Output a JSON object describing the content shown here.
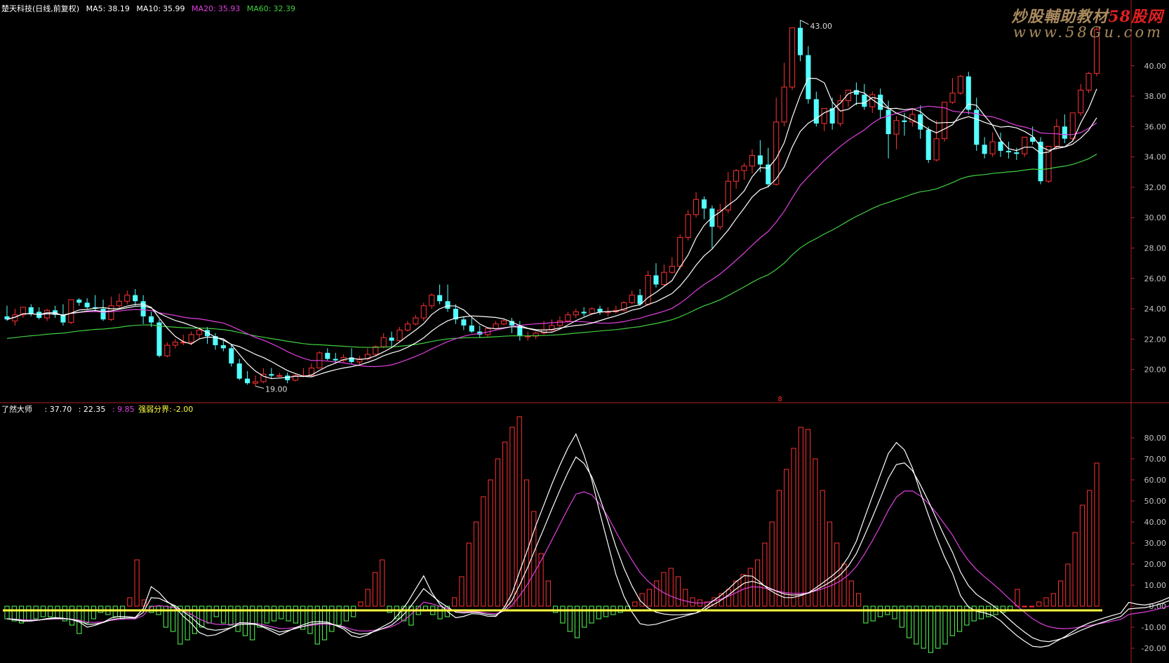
{
  "header": {
    "stock_title": "楚天科技(日线,前复权)",
    "ma5": {
      "label": "MA5:",
      "value": "38.19",
      "color": "#ffffff"
    },
    "ma10": {
      "label": "MA10:",
      "value": "35.99",
      "color": "#ffffff"
    },
    "ma20": {
      "label": "MA20:",
      "value": "35.93",
      "color": "#e040e0"
    },
    "ma60": {
      "label": "MA60:",
      "value": "32.39",
      "color": "#40d040"
    }
  },
  "watermark": {
    "line1_prefix": "炒股輔助教材",
    "line1_brand": "58股网",
    "line2": "www.58Gu.com"
  },
  "price_panel": {
    "y_ticks": [
      "20.00",
      "22.00",
      "24.00",
      "26.00",
      "28.00",
      "30.00",
      "32.00",
      "34.00",
      "36.00",
      "38.00",
      "40.00"
    ],
    "high_annotation": "43.00",
    "low_annotation": "19.00",
    "marker_label": "8"
  },
  "indicator_panel": {
    "title": "了然大师",
    "values": [
      {
        "text": ": 37.70",
        "color": "#ffffff"
      },
      {
        "text": ": 22.35",
        "color": "#ffffff"
      },
      {
        "text": ": 9.85",
        "color": "#e040e0"
      }
    ],
    "boundary": {
      "label": "强弱分界:",
      "value": "-2.00",
      "color": "#ffff40"
    },
    "y_ticks": [
      "-20.00",
      "-10.00",
      "0.00",
      "10.00",
      "20.00",
      "30.00",
      "40.00",
      "50.00",
      "60.00",
      "70.00",
      "80.00"
    ]
  },
  "chart_data": [
    {
      "type": "candlestick",
      "title": "楚天科技(日线,前复权)",
      "ylim": [
        18,
        43.5
      ],
      "up_color": "#ff3232",
      "down_color": "#54ffff",
      "candles": [
        [
          23.5,
          24.2,
          23.3,
          23.2
        ],
        [
          23.2,
          24.0,
          23.6,
          22.9
        ],
        [
          23.6,
          24.1,
          24.1,
          23.4
        ],
        [
          24.1,
          24.3,
          23.7,
          23.5
        ],
        [
          23.8,
          24.1,
          23.4,
          23.3
        ],
        [
          23.4,
          24.0,
          23.9,
          23.2
        ],
        [
          23.9,
          24.2,
          23.6,
          23.4
        ],
        [
          23.6,
          24.3,
          23.1,
          22.9
        ],
        [
          23.1,
          24.6,
          24.6,
          23.0
        ],
        [
          24.6,
          24.7,
          24.4,
          24.2
        ],
        [
          24.4,
          24.7,
          24.1,
          24.0
        ],
        [
          24.1,
          24.9,
          24.0,
          23.8
        ],
        [
          24.0,
          24.6,
          23.3,
          23.2
        ],
        [
          23.3,
          24.8,
          24.2,
          23.2
        ],
        [
          24.2,
          25.0,
          24.5,
          24.0
        ],
        [
          24.5,
          25.2,
          24.9,
          24.3
        ],
        [
          24.9,
          25.3,
          24.5,
          24.2
        ],
        [
          24.5,
          24.9,
          23.5,
          23.0
        ],
        [
          23.5,
          23.8,
          23.1,
          22.8
        ],
        [
          23.1,
          23.3,
          20.9,
          20.8
        ],
        [
          20.9,
          21.8,
          21.6,
          20.8
        ],
        [
          21.6,
          22.0,
          21.8,
          21.4
        ],
        [
          21.8,
          22.3,
          21.8,
          21.6
        ],
        [
          21.8,
          22.5,
          22.3,
          21.6
        ],
        [
          22.3,
          22.7,
          22.6,
          22.0
        ],
        [
          22.6,
          22.8,
          22.2,
          21.7
        ],
        [
          22.2,
          22.4,
          21.6,
          21.3
        ],
        [
          21.6,
          21.9,
          21.4,
          21.2
        ],
        [
          21.4,
          21.7,
          20.4,
          20.2
        ],
        [
          20.4,
          20.7,
          19.4,
          19.3
        ],
        [
          19.4,
          19.9,
          19.1,
          19.0
        ],
        [
          19.1,
          19.6,
          19.2,
          18.9
        ],
        [
          19.2,
          20.1,
          19.7,
          19.1
        ],
        [
          19.7,
          20.1,
          19.6,
          19.4
        ],
        [
          19.6,
          19.8,
          19.6,
          19.5
        ],
        [
          19.6,
          19.8,
          19.3,
          19.1
        ],
        [
          19.3,
          19.7,
          19.6,
          19.2
        ],
        [
          19.6,
          20.1,
          19.6,
          19.5
        ],
        [
          19.6,
          20.4,
          20.1,
          19.5
        ],
        [
          20.1,
          21.2,
          21.1,
          20.1
        ],
        [
          21.1,
          21.4,
          20.7,
          20.6
        ],
        [
          20.7,
          21.1,
          20.6,
          20.4
        ],
        [
          20.6,
          21.0,
          20.8,
          20.5
        ],
        [
          20.8,
          21.4,
          20.5,
          20.4
        ],
        [
          20.5,
          20.9,
          20.7,
          20.3
        ],
        [
          20.7,
          21.4,
          21.0,
          20.6
        ],
        [
          21.0,
          21.6,
          21.5,
          20.9
        ],
        [
          21.5,
          22.4,
          22.1,
          21.4
        ],
        [
          22.1,
          22.5,
          21.9,
          21.5
        ],
        [
          21.9,
          22.8,
          22.6,
          21.8
        ],
        [
          22.6,
          23.2,
          23.0,
          22.5
        ],
        [
          23.0,
          23.6,
          23.4,
          22.9
        ],
        [
          23.4,
          24.4,
          24.2,
          23.2
        ],
        [
          24.2,
          25.0,
          24.9,
          24.0
        ],
        [
          24.9,
          25.6,
          24.5,
          24.3
        ],
        [
          24.5,
          25.6,
          24.0,
          23.8
        ],
        [
          24.0,
          24.3,
          23.3,
          23.0
        ],
        [
          23.3,
          23.5,
          22.9,
          22.6
        ],
        [
          22.9,
          23.4,
          22.5,
          22.4
        ],
        [
          22.5,
          22.9,
          22.3,
          22.1
        ],
        [
          22.3,
          22.8,
          22.7,
          22.1
        ],
        [
          22.7,
          23.2,
          23.0,
          22.6
        ],
        [
          23.0,
          23.3,
          23.2,
          22.9
        ],
        [
          23.2,
          23.4,
          22.9,
          22.4
        ],
        [
          22.9,
          23.2,
          22.2,
          21.9
        ],
        [
          22.2,
          22.5,
          22.2,
          21.9
        ],
        [
          22.2,
          22.5,
          22.4,
          22.0
        ],
        [
          22.4,
          23.2,
          22.6,
          22.3
        ],
        [
          22.6,
          23.3,
          22.9,
          22.5
        ],
        [
          22.9,
          23.5,
          23.2,
          22.8
        ],
        [
          23.2,
          23.8,
          23.6,
          23.1
        ],
        [
          23.6,
          24.0,
          23.8,
          23.4
        ],
        [
          23.8,
          24.1,
          23.7,
          23.5
        ],
        [
          23.7,
          24.1,
          24.0,
          23.6
        ],
        [
          24.0,
          24.2,
          23.8,
          23.6
        ],
        [
          23.8,
          24.1,
          23.8,
          23.5
        ],
        [
          23.8,
          24.2,
          23.9,
          23.7
        ],
        [
          23.9,
          24.5,
          24.4,
          23.8
        ],
        [
          24.4,
          25.2,
          24.9,
          24.3
        ],
        [
          24.9,
          25.3,
          24.3,
          24.2
        ],
        [
          24.3,
          26.5,
          26.2,
          24.2
        ],
        [
          26.2,
          27.0,
          25.6,
          25.4
        ],
        [
          25.6,
          26.9,
          26.4,
          25.5
        ],
        [
          26.4,
          27.4,
          26.8,
          26.3
        ],
        [
          26.8,
          28.9,
          28.7,
          26.6
        ],
        [
          28.7,
          30.5,
          30.2,
          28.5
        ],
        [
          30.2,
          31.7,
          31.2,
          30.0
        ],
        [
          31.2,
          31.4,
          30.6,
          29.9
        ],
        [
          30.6,
          30.8,
          29.4,
          28.0
        ],
        [
          29.4,
          30.9,
          30.5,
          29.2
        ],
        [
          30.5,
          33.0,
          32.4,
          30.3
        ],
        [
          32.4,
          33.2,
          33.1,
          31.9
        ],
        [
          33.1,
          33.6,
          33.4,
          32.5
        ],
        [
          33.4,
          34.5,
          34.1,
          32.9
        ],
        [
          34.1,
          35.1,
          33.5,
          33.0
        ],
        [
          33.5,
          34.6,
          32.2,
          32.0
        ],
        [
          32.2,
          37.9,
          36.3,
          32.1
        ],
        [
          36.3,
          40.2,
          38.6,
          36.0
        ],
        [
          38.6,
          41.6,
          42.5,
          38.4
        ],
        [
          42.5,
          43.0,
          40.7,
          40.3
        ],
        [
          40.7,
          41.3,
          37.8,
          37.5
        ],
        [
          37.8,
          38.3,
          36.2,
          36.0
        ],
        [
          36.2,
          37.2,
          37.2,
          35.7
        ],
        [
          37.2,
          37.9,
          36.2,
          35.8
        ],
        [
          36.2,
          38.1,
          37.7,
          36.0
        ],
        [
          37.7,
          38.4,
          38.4,
          37.3
        ],
        [
          38.4,
          38.9,
          38.1,
          37.4
        ],
        [
          38.1,
          38.8,
          37.3,
          37.1
        ],
        [
          37.3,
          38.3,
          38.1,
          36.9
        ],
        [
          38.1,
          38.5,
          37.1,
          36.5
        ],
        [
          37.1,
          37.7,
          35.5,
          33.9
        ],
        [
          35.5,
          36.7,
          36.4,
          34.5
        ],
        [
          36.4,
          36.9,
          36.3,
          35.4
        ],
        [
          36.3,
          37.2,
          36.8,
          36.0
        ],
        [
          36.8,
          37.4,
          35.8,
          35.2
        ],
        [
          35.8,
          36.0,
          33.8,
          33.6
        ],
        [
          33.8,
          36.4,
          35.2,
          33.7
        ],
        [
          35.2,
          37.1,
          37.6,
          35.0
        ],
        [
          37.6,
          39.2,
          38.2,
          37.5
        ],
        [
          38.2,
          39.4,
          39.3,
          38.1
        ],
        [
          39.3,
          39.6,
          37.1,
          36.8
        ],
        [
          37.1,
          37.9,
          34.8,
          34.4
        ],
        [
          34.8,
          35.3,
          34.2,
          33.9
        ],
        [
          34.2,
          35.6,
          35.0,
          34.0
        ],
        [
          35.0,
          35.6,
          34.4,
          34.0
        ],
        [
          34.4,
          35.0,
          34.3,
          33.9
        ],
        [
          34.3,
          34.6,
          34.2,
          33.8
        ],
        [
          34.2,
          35.0,
          35.3,
          34.0
        ],
        [
          35.3,
          36.0,
          35.0,
          34.8
        ],
        [
          35.0,
          35.3,
          32.4,
          32.2
        ],
        [
          32.4,
          34.6,
          34.7,
          32.3
        ],
        [
          34.7,
          36.5,
          36.0,
          34.5
        ],
        [
          36.0,
          36.8,
          35.2,
          34.9
        ],
        [
          35.2,
          36.3,
          36.9,
          35.0
        ],
        [
          36.9,
          38.8,
          38.4,
          36.7
        ],
        [
          38.4,
          39.6,
          39.5,
          38.2
        ],
        [
          39.5,
          42.6,
          42.4,
          39.3
        ]
      ],
      "series": [
        {
          "name": "MA5",
          "color": "#ffffff"
        },
        {
          "name": "MA10",
          "color": "#ffffff"
        },
        {
          "name": "MA20",
          "color": "#e040e0"
        },
        {
          "name": "MA60",
          "color": "#40d040"
        }
      ]
    },
    {
      "type": "bar",
      "title": "了然大师",
      "ylim": [
        -25,
        92
      ],
      "boundary_value": -2,
      "up_color": "#ff3232",
      "down_color": "#54ff54",
      "line_colors": [
        "#ffffff",
        "#ffffff",
        "#e040e0"
      ],
      "values": [
        -6,
        -7,
        -8,
        -7,
        -6,
        -5,
        -5,
        -6,
        -7,
        -9,
        -13,
        -8,
        -6,
        -3,
        -4,
        -5,
        -6,
        4,
        22,
        3,
        -3,
        -4,
        -10,
        -12,
        -18,
        -16,
        -13,
        -10,
        -8,
        -5,
        -8,
        -9,
        -12,
        -14,
        -16,
        -10,
        -8,
        -7,
        -6,
        -7,
        -8,
        -11,
        -13,
        -18,
        -16,
        -12,
        -9,
        -7,
        -5,
        2,
        8,
        16,
        22,
        -3,
        -6,
        -7,
        -9,
        -4,
        -2,
        -4,
        -6,
        -5,
        4,
        14,
        30,
        40,
        52,
        60,
        70,
        78,
        85,
        90,
        60,
        45,
        25,
        12,
        -3,
        -8,
        -12,
        -15,
        -10,
        -8,
        -6,
        -5,
        -4,
        -3,
        -2,
        2,
        6,
        8,
        12,
        16,
        18,
        14,
        8,
        4,
        3,
        2,
        4,
        6,
        8,
        12,
        15,
        18,
        22,
        30,
        40,
        55,
        65,
        75,
        85,
        84,
        70,
        55,
        40,
        30,
        20,
        12,
        6,
        -8,
        -7,
        -5,
        -4,
        -6,
        -10,
        -15,
        -18,
        -20,
        -22,
        -20,
        -18,
        -14,
        -12,
        -9,
        -7,
        -6,
        -5,
        -4,
        -3,
        -2,
        8,
        0,
        0,
        2,
        4,
        6,
        12,
        20,
        35,
        48,
        55,
        68
      ]
    }
  ]
}
